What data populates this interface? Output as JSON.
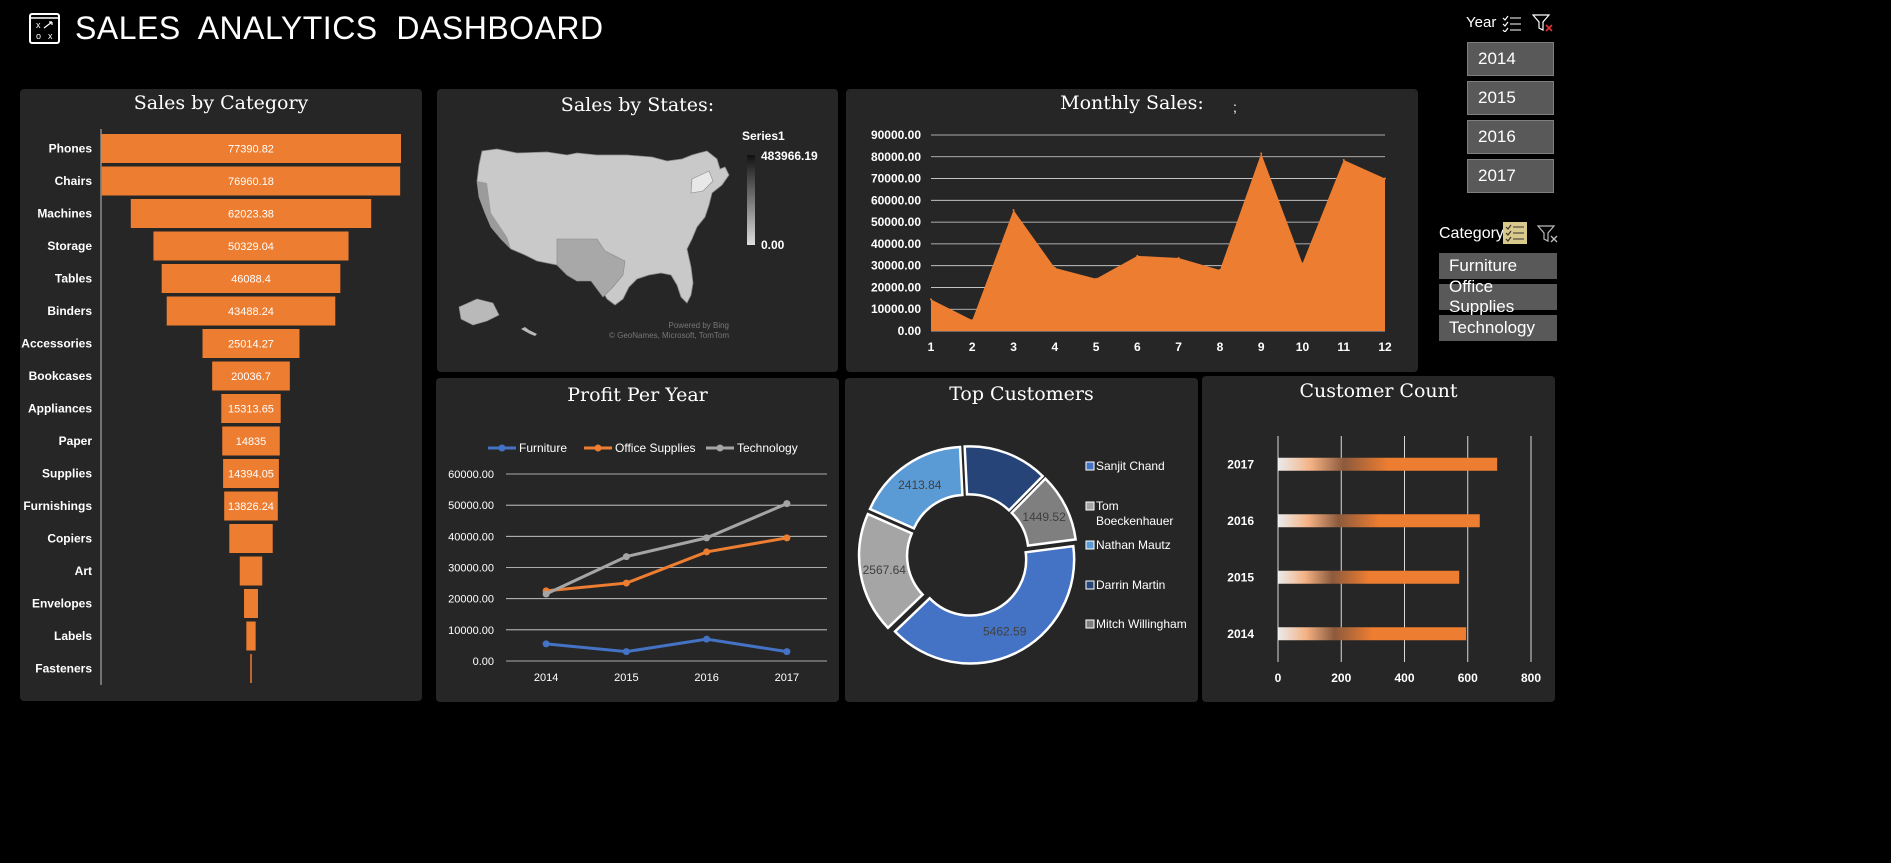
{
  "header": {
    "title": "SALES  ANALYTICS  DASHBOARD",
    "logo_icon": "strategy-board-icon"
  },
  "year_slicer": {
    "label": "Year",
    "items": [
      "2014",
      "2015",
      "2016",
      "2017"
    ],
    "multiselect_icon": "multiselect-icon",
    "clear_filter_icon": "clear-filter-icon"
  },
  "category_slicer": {
    "label": "Category",
    "items": [
      "Furniture",
      "Office Supplies",
      "Technology"
    ],
    "multiselect_icon": "multiselect-icon",
    "clear_filter_icon": "clear-filter-icon"
  },
  "colors": {
    "orange": "#ED7D31",
    "panel": "#262626",
    "grey": "#A5A5A5",
    "blue": "#4472C4",
    "background": "#000000"
  },
  "panels": {
    "sales_by_category": {
      "title": "Sales by Category"
    },
    "sales_by_states": {
      "title": "Sales by States:",
      "legend_series": "Series1",
      "legend_max": "483966.19",
      "legend_min": "0.00",
      "attribution_1": "Powered by Bing",
      "attribution_2": "© GeoNames, Microsoft, TomTom"
    },
    "monthly_sales": {
      "title": "Monthly Sales:",
      "stray_mark": ";"
    },
    "profit_per_year": {
      "title": "Profit Per Year"
    },
    "top_customers": {
      "title": "Top Customers"
    },
    "customer_count": {
      "title": "Customer Count"
    }
  },
  "chart_data": [
    {
      "id": "sales_by_category",
      "type": "bar",
      "orientation": "horizontal-funnel",
      "title": "Sales by Category",
      "categories": [
        "Phones",
        "Chairs",
        "Machines",
        "Storage",
        "Tables",
        "Binders",
        "Accessories",
        "Bookcases",
        "Appliances",
        "Paper",
        "Supplies",
        "Furnishings",
        "Copiers",
        "Art",
        "Envelopes",
        "Labels",
        "Fasteners"
      ],
      "values": [
        77390.82,
        76960.18,
        62023.38,
        50329.04,
        46088.4,
        43488.24,
        25014.27,
        20036.7,
        15313.65,
        14835,
        14394.05,
        13826.24,
        11200,
        5800,
        3600,
        2400,
        320
      ],
      "labels": [
        "77390.82",
        "76960.18",
        "62023.38",
        "50329.04",
        "46088.4",
        "43488.24",
        "25014.27",
        "20036.7",
        "15313.65",
        "14835",
        "14394.05",
        "13826.24",
        "",
        "",
        "",
        "",
        ""
      ],
      "color": "#ED7D31"
    },
    {
      "id": "monthly_sales",
      "type": "area",
      "title": "Monthly Sales:",
      "x": [
        1,
        2,
        3,
        4,
        5,
        6,
        7,
        8,
        9,
        10,
        11,
        12
      ],
      "values": [
        14500,
        5000,
        55500,
        29000,
        24000,
        34500,
        33500,
        28000,
        81500,
        31000,
        78500,
        70000
      ],
      "y_ticks": [
        "0.00",
        "10000.00",
        "20000.00",
        "30000.00",
        "40000.00",
        "50000.00",
        "60000.00",
        "70000.00",
        "80000.00",
        "90000.00"
      ],
      "ylim": [
        0,
        90000
      ],
      "grid": true,
      "color": "#ED7D31"
    },
    {
      "id": "profit_per_year",
      "type": "line",
      "title": "Profit Per Year",
      "categories": [
        "2014",
        "2015",
        "2016",
        "2017"
      ],
      "series": [
        {
          "name": "Furniture",
          "values": [
            5500,
            3000,
            7000,
            3000
          ],
          "color": "#4472C4"
        },
        {
          "name": "Office Supplies",
          "values": [
            22500,
            25000,
            35000,
            39500
          ],
          "color": "#ED7D31"
        },
        {
          "name": "Technology",
          "values": [
            21500,
            33500,
            39500,
            50500
          ],
          "color": "#A5A5A5"
        }
      ],
      "y_ticks": [
        "0.00",
        "10000.00",
        "20000.00",
        "30000.00",
        "40000.00",
        "50000.00",
        "60000.00"
      ],
      "ylim": [
        0,
        60000
      ],
      "legend": "top",
      "grid": true
    },
    {
      "id": "top_customers",
      "type": "pie",
      "subtype": "doughnut",
      "title": "Top Customers",
      "slices": [
        {
          "name": "Sanjit Chand",
          "value": 1800,
          "label": "",
          "color": "#264478"
        },
        {
          "name": "Tom Boeckenhauer",
          "value": 1449.52,
          "label": "1449.52",
          "color": "#7F7F7F"
        },
        {
          "name": "Nathan Mautz",
          "value": 5462.59,
          "label": "5462.59",
          "color": "#4472C4"
        },
        {
          "name": "Darrin Martin",
          "value": 2567.64,
          "label": "2567.64",
          "color": "#A5A5A5"
        },
        {
          "name": "Mitch Willingham",
          "value": 2413.84,
          "label": "2413.84",
          "color": "#5B9BD5"
        }
      ],
      "legend": "right"
    },
    {
      "id": "customer_count",
      "type": "bar",
      "orientation": "horizontal",
      "title": "Customer Count",
      "categories": [
        "2017",
        "2016",
        "2015",
        "2014"
      ],
      "values": [
        693,
        638,
        573,
        595
      ],
      "x_ticks": [
        "0",
        "200",
        "400",
        "600",
        "800"
      ],
      "xlim": [
        0,
        800
      ],
      "grid": true,
      "color": "#ED7D31"
    }
  ]
}
